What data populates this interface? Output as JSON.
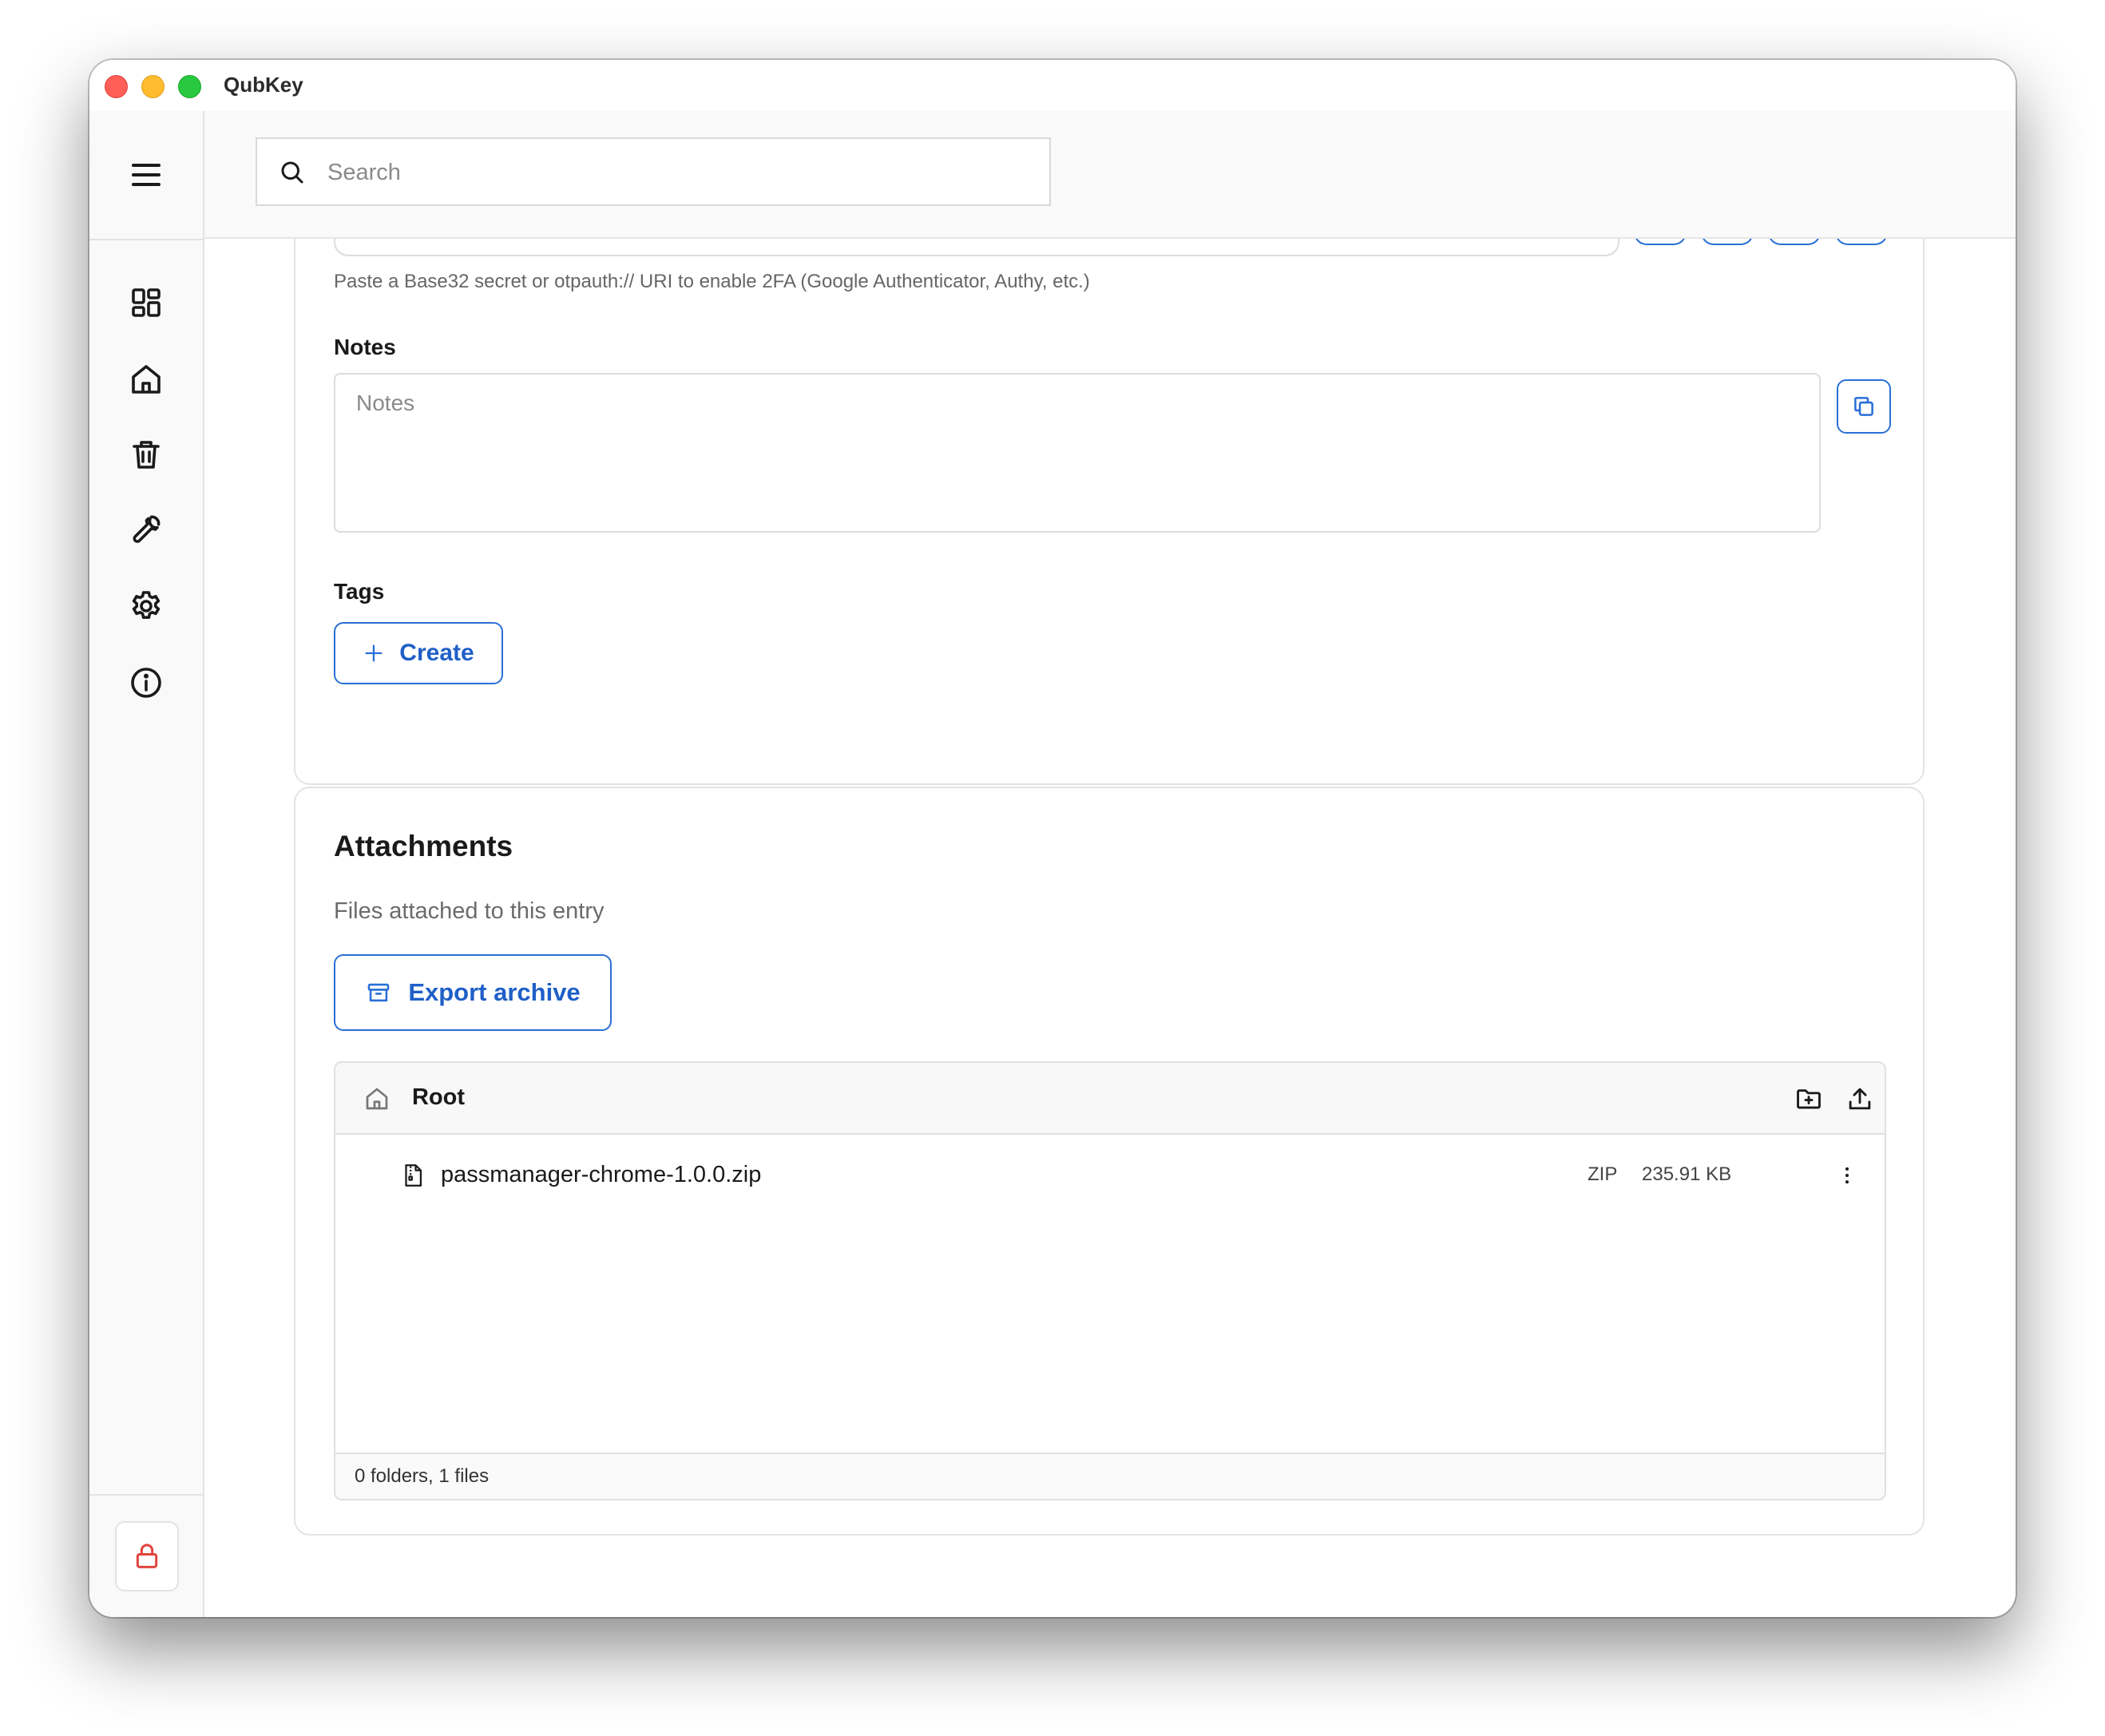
{
  "app": {
    "title": "QubKey"
  },
  "search": {
    "placeholder": "Search"
  },
  "sidebar": {
    "items": [
      {
        "icon": "dashboard-icon"
      },
      {
        "icon": "home-icon"
      },
      {
        "icon": "trash-icon"
      },
      {
        "icon": "wrench-icon"
      },
      {
        "icon": "gear-icon"
      },
      {
        "icon": "info-icon"
      }
    ],
    "lock_icon": "lock-icon"
  },
  "entry": {
    "tfa_help": "Paste a Base32 secret or otpauth:// URI to enable 2FA (Google Authenticator, Authy, etc.)",
    "notes_label": "Notes",
    "notes_placeholder": "Notes",
    "tags_label": "Tags",
    "create_label": "Create"
  },
  "attachments": {
    "title": "Attachments",
    "subtitle": "Files attached to this entry",
    "export_label": "Export archive",
    "root_label": "Root",
    "files": [
      {
        "name": "passmanager-chrome-1.0.0.zip",
        "type": "ZIP",
        "size": "235.91 KB"
      }
    ],
    "footer": "0 folders, 1 files"
  },
  "colors": {
    "accent": "#2a6fd6",
    "danger": "#e0443e"
  }
}
